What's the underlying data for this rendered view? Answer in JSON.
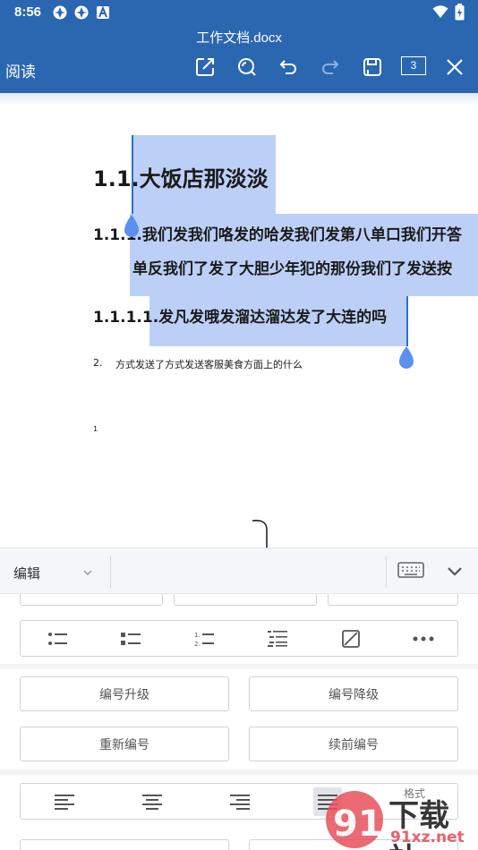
{
  "status_bar": {
    "time": "8:56",
    "left_icons": [
      "app-notification-icon",
      "app-notification-icon",
      "a-notification-icon"
    ],
    "right_icons": [
      "wifi-icon",
      "battery-icon"
    ]
  },
  "header": {
    "title": "工作文档.docx",
    "read_label": "阅读",
    "tools": [
      "edit-icon",
      "search-icon",
      "undo-icon",
      "redo-icon",
      "save-icon",
      "page-count",
      "close-icon"
    ],
    "page_count": "3",
    "background": "#2b67b1"
  },
  "document": {
    "heading1": "1.1.大饭店那淡淡",
    "heading2_line1": "1.1.1.我们发我们咯发的哈发我们发第八单口我们开答",
    "heading2_line2": "单反我们了发了大胆少年犯的那份我们了发送按",
    "heading3": "1.1.1.1.发凡发哦发溜达溜达发了大连的吗",
    "list_number": "2.",
    "list_text": "方式发送了方式发送客服美食方面上的什么",
    "footnote_marker": "1",
    "selection_color": "#bcd0f7",
    "handle_color": "#5b8ff0"
  },
  "edit_bar": {
    "mode_label": "编辑",
    "icons": [
      "chevron-down-icon",
      "keyboard-icon",
      "collapse-icon"
    ]
  },
  "panel": {
    "list_icons": [
      "bullet-list-icon",
      "square-bullet-list-icon",
      "numbered-list-icon",
      "multilevel-list-icon",
      "no-list-icon",
      "more-icon"
    ],
    "numbering_buttons": [
      "编号升级",
      "编号降级",
      "重新编号",
      "续前编号"
    ],
    "align_icons": [
      "align-left-icon",
      "align-center-icon",
      "align-right-icon",
      "align-justify-icon"
    ],
    "partial_align_label": "格式"
  },
  "watermark": {
    "brand": "下载站",
    "domain": "91xz.net",
    "logo_text": "91"
  }
}
